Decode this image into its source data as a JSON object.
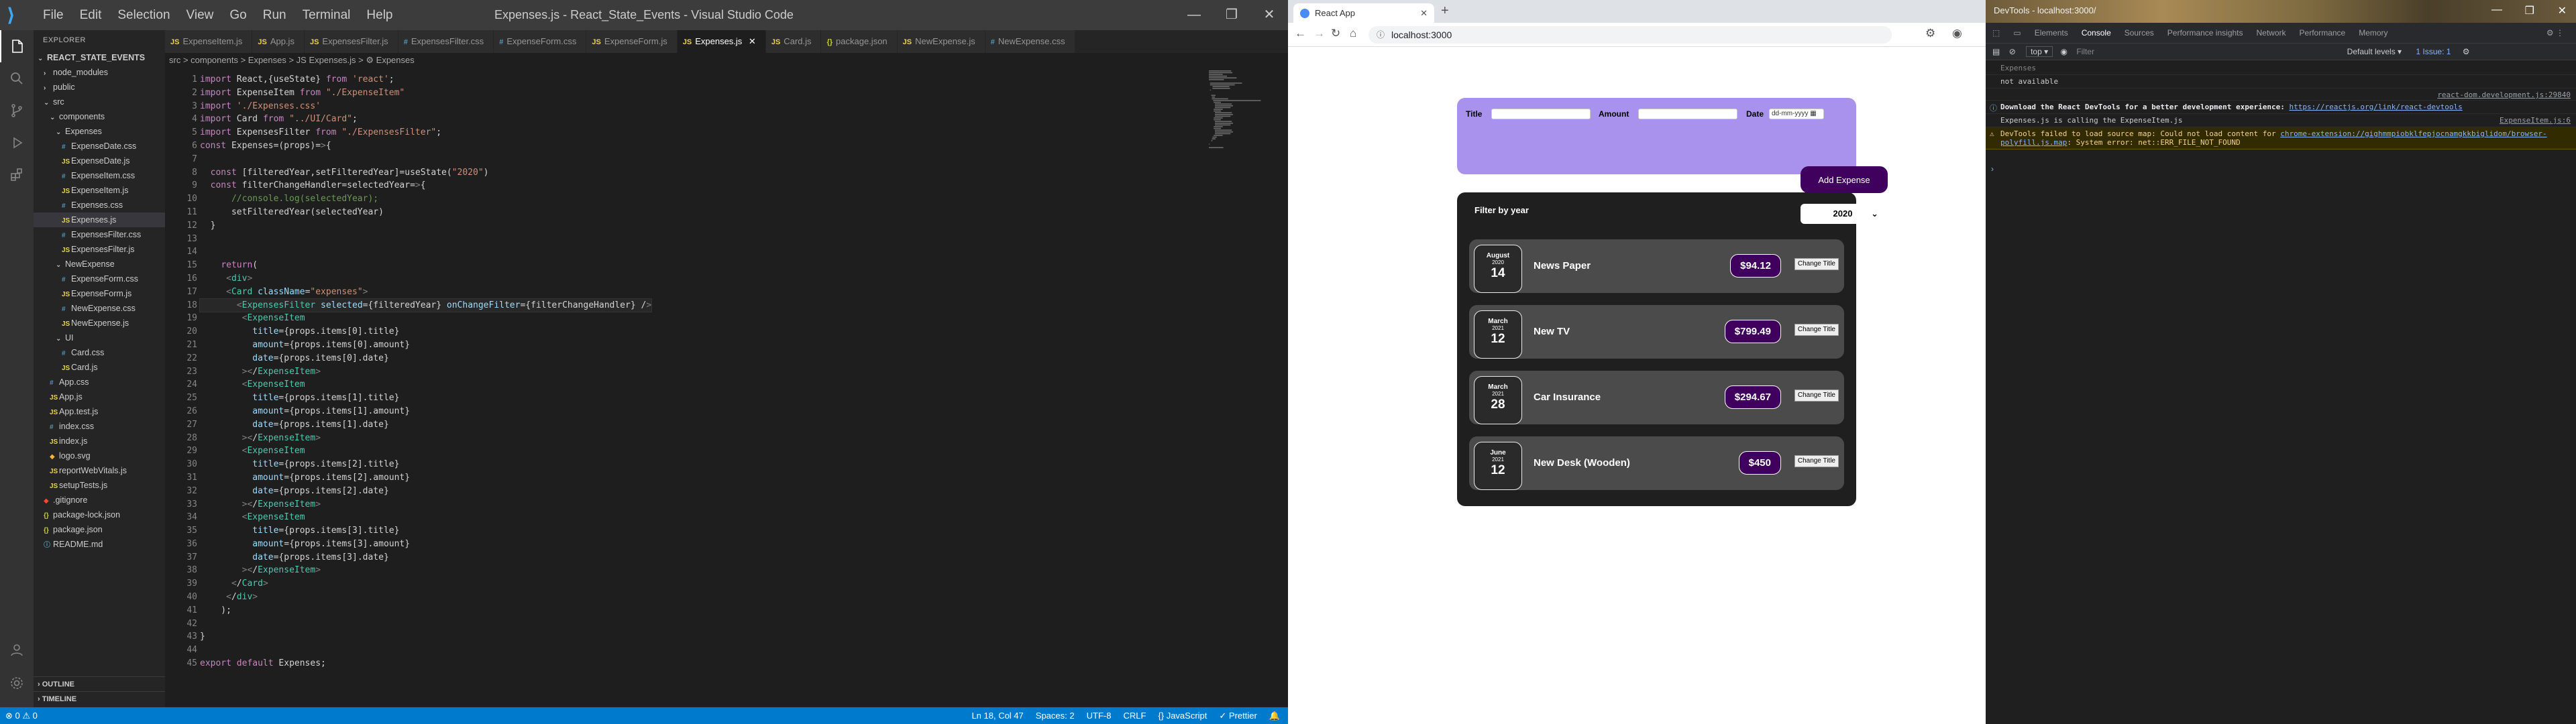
{
  "vscode": {
    "title": "Expenses.js - React_State_Events - Visual Studio Code",
    "menu": [
      "File",
      "Edit",
      "Selection",
      "View",
      "Go",
      "Run",
      "Terminal",
      "Help"
    ],
    "explorer_header": "EXPLORER",
    "tree": [
      {
        "label": "REACT_STATE_EVENTS",
        "depth": 0,
        "type": "folder-open",
        "bold": true
      },
      {
        "label": "node_modules",
        "depth": 1,
        "type": "folder"
      },
      {
        "label": "public",
        "depth": 1,
        "type": "folder"
      },
      {
        "label": "src",
        "depth": 1,
        "type": "folder-open"
      },
      {
        "label": "components",
        "depth": 2,
        "type": "folder-open"
      },
      {
        "label": "Expenses",
        "depth": 3,
        "type": "folder-open"
      },
      {
        "label": "ExpenseDate.css",
        "depth": 4,
        "type": "css"
      },
      {
        "label": "ExpenseDate.js",
        "depth": 4,
        "type": "js"
      },
      {
        "label": "ExpenseItem.css",
        "depth": 4,
        "type": "css"
      },
      {
        "label": "ExpenseItem.js",
        "depth": 4,
        "type": "js"
      },
      {
        "label": "Expenses.css",
        "depth": 4,
        "type": "css"
      },
      {
        "label": "Expenses.js",
        "depth": 4,
        "type": "js",
        "selected": true
      },
      {
        "label": "ExpensesFilter.css",
        "depth": 4,
        "type": "css"
      },
      {
        "label": "ExpensesFilter.js",
        "depth": 4,
        "type": "js"
      },
      {
        "label": "NewExpense",
        "depth": 3,
        "type": "folder-open"
      },
      {
        "label": "ExpenseForm.css",
        "depth": 4,
        "type": "css"
      },
      {
        "label": "ExpenseForm.js",
        "depth": 4,
        "type": "js"
      },
      {
        "label": "NewExpense.css",
        "depth": 4,
        "type": "css"
      },
      {
        "label": "NewExpense.js",
        "depth": 4,
        "type": "js"
      },
      {
        "label": "UI",
        "depth": 3,
        "type": "folder-open"
      },
      {
        "label": "Card.css",
        "depth": 4,
        "type": "css"
      },
      {
        "label": "Card.js",
        "depth": 4,
        "type": "js"
      },
      {
        "label": "App.css",
        "depth": 2,
        "type": "css"
      },
      {
        "label": "App.js",
        "depth": 2,
        "type": "js"
      },
      {
        "label": "App.test.js",
        "depth": 2,
        "type": "js"
      },
      {
        "label": "index.css",
        "depth": 2,
        "type": "css"
      },
      {
        "label": "index.js",
        "depth": 2,
        "type": "js"
      },
      {
        "label": "logo.svg",
        "depth": 2,
        "type": "svg"
      },
      {
        "label": "reportWebVitals.js",
        "depth": 2,
        "type": "js"
      },
      {
        "label": "setupTests.js",
        "depth": 2,
        "type": "js"
      },
      {
        "label": ".gitignore",
        "depth": 1,
        "type": "git"
      },
      {
        "label": "package-lock.json",
        "depth": 1,
        "type": "json"
      },
      {
        "label": "package.json",
        "depth": 1,
        "type": "json"
      },
      {
        "label": "README.md",
        "depth": 1,
        "type": "md"
      }
    ],
    "outline": "OUTLINE",
    "timeline": "TIMELINE",
    "tabs": [
      {
        "label": "ExpenseItem.js",
        "type": "js"
      },
      {
        "label": "App.js",
        "type": "js"
      },
      {
        "label": "ExpensesFilter.js",
        "type": "js"
      },
      {
        "label": "ExpensesFilter.css",
        "type": "css"
      },
      {
        "label": "ExpenseForm.css",
        "type": "css"
      },
      {
        "label": "ExpenseForm.js",
        "type": "js"
      },
      {
        "label": "Expenses.js",
        "type": "js",
        "active": true
      },
      {
        "label": "Card.js",
        "type": "js"
      },
      {
        "label": "package.json",
        "type": "json"
      },
      {
        "label": "NewExpense.js",
        "type": "js"
      },
      {
        "label": "NewExpense.css",
        "type": "css"
      }
    ],
    "breadcrumb": "src > components > Expenses > JS Expenses.js > ⚙ Expenses",
    "code_lines": [
      "import React,{useState} from 'react';",
      "import ExpenseItem from \"./ExpenseItem\"",
      "import './Expenses.css'",
      "import Card from \"../UI/Card\";",
      "import ExpensesFilter from \"./ExpensesFilter\";",
      "const Expenses=(props)=>{",
      "",
      "  const [filteredYear,setFilteredYear]=useState(\"2020\")",
      "  const filterChangeHandler=selectedYear=>{",
      "      //console.log(selectedYear);",
      "      setFilteredYear(selectedYear)",
      "  }",
      "",
      "",
      "    return(",
      "     <div>",
      "     <Card className=\"expenses\">",
      "       <ExpensesFilter selected={filteredYear} onChangeFilter={filterChangeHandler} />",
      "        <ExpenseItem",
      "          title={props.items[0].title}",
      "          amount={props.items[0].amount}",
      "          date={props.items[0].date}",
      "        ></ExpenseItem>",
      "        <ExpenseItem",
      "          title={props.items[1].title}",
      "          amount={props.items[1].amount}",
      "          date={props.items[1].date}",
      "        ></ExpenseItem>",
      "        <ExpenseItem",
      "          title={props.items[2].title}",
      "          amount={props.items[2].amount}",
      "          date={props.items[2].date}",
      "        ></ExpenseItem>",
      "        <ExpenseItem",
      "          title={props.items[3].title}",
      "          amount={props.items[3].amount}",
      "          date={props.items[3].date}",
      "        ></ExpenseItem>",
      "      </Card>",
      "     </div>",
      "    );",
      "",
      "}",
      "",
      "export default Expenses;"
    ],
    "status_left": "⊗ 0 ⚠ 0",
    "status_right": [
      "Ln 18, Col 47",
      "Spaces: 2",
      "UTF-8",
      "CRLF",
      "{} JavaScript",
      "✓ Prettier"
    ]
  },
  "chrome": {
    "tab_title": "React App",
    "url": "localhost:3000",
    "form": {
      "title_label": "Title",
      "amount_label": "Amount",
      "date_label": "Date",
      "date_placeholder": "dd-mm-yyyy",
      "add_button": "Add Expense"
    },
    "filter": {
      "label": "Filter by year",
      "selected": "2020"
    },
    "expenses": [
      {
        "month": "August",
        "year": "2020",
        "day": "14",
        "title": "News Paper",
        "amount": "$94.12"
      },
      {
        "month": "March",
        "year": "2021",
        "day": "12",
        "title": "New TV",
        "amount": "$799.49"
      },
      {
        "month": "March",
        "year": "2021",
        "day": "28",
        "title": "Car Insurance",
        "amount": "$294.67"
      },
      {
        "month": "June",
        "year": "2021",
        "day": "12",
        "title": "New Desk (Wooden)",
        "amount": "$450"
      }
    ],
    "change_title": "Change Title"
  },
  "devtools": {
    "window_title": "DevTools - localhost:3000/",
    "tabs": [
      "Elements",
      "Console",
      "Sources",
      "Performance insights",
      "Network",
      "Performance",
      "Memory"
    ],
    "active_tab": "Console",
    "context": "top",
    "filter_placeholder": "Filter",
    "levels": "Default levels",
    "issues": "1 Issue: 1",
    "console": [
      {
        "type": "log",
        "text": "Expenses",
        "dim": true
      },
      {
        "type": "log",
        "text": "not available"
      },
      {
        "type": "link",
        "src": "react-dom.development.js:29840"
      },
      {
        "type": "info",
        "bold": "Download the React DevTools for a better development experience: ",
        "link": "https://reactjs.org/link/react-devtools"
      },
      {
        "type": "log",
        "text": "Expenses.js is calling the ExpenseItem.js",
        "src": "ExpenseItem.js:6"
      },
      {
        "type": "warn",
        "text": "DevTools failed to load source map: Could not load content for ",
        "link": "chrome-extension://gighmmpiobklfepjocnamgkkbiglidom/browser-polyfill.js.map",
        "tail": ": System error: net::ERR_FILE_NOT_FOUND"
      }
    ]
  }
}
